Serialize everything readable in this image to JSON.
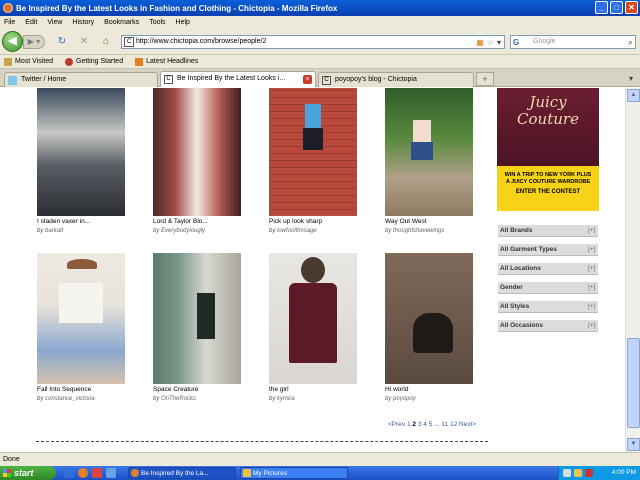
{
  "window": {
    "title": "Be Inspired By the Latest Looks in Fashion and Clothing - Chictopia - Mozilla Firefox"
  },
  "menu": [
    "File",
    "Edit",
    "View",
    "History",
    "Bookmarks",
    "Tools",
    "Help"
  ],
  "nav": {
    "url": "http://www.chictopia.com/browse/people/2",
    "search_placeholder": "Google"
  },
  "bookmarks": [
    "Most Visited",
    "Getting Started",
    "Latest Headlines"
  ],
  "tabs": [
    {
      "label": "Twitter / Home",
      "active": false
    },
    {
      "label": "Be Inspired By the Latest Looks i...",
      "active": true
    },
    {
      "label": "poyopoy's blog - Chictopia",
      "active": false
    }
  ],
  "looks": [
    {
      "title": "I staden vaxer in...",
      "author": "barkatt"
    },
    {
      "title": "Lord & Taylor Blo...",
      "author": "Everybodyiougly"
    },
    {
      "title": "Pick up look sharp",
      "author": "lowfoolfimsage"
    },
    {
      "title": "Way Out West",
      "author": "thoughtshavewings"
    },
    {
      "title": "Fall Into Sequence",
      "author": "constance_victoria"
    },
    {
      "title": "Space Creature",
      "author": "OnTheRocks"
    },
    {
      "title": "the girl",
      "author": "kymira"
    },
    {
      "title": "Hi world",
      "author": "poyopoy"
    }
  ],
  "ad": {
    "brand": "Juicy Couture",
    "line1": "WIN A TRIP TO NEW YORK PLUS",
    "line2": "A JUICY COUTURE WARDROBE",
    "cta": "ENTER THE CONTEST"
  },
  "filters": [
    {
      "label": "All Brands",
      "toggle": "[+]"
    },
    {
      "label": "All Garment Types",
      "toggle": "[+]"
    },
    {
      "label": "All Locations",
      "toggle": "[+]"
    },
    {
      "label": "Gender",
      "toggle": "[+]"
    },
    {
      "label": "All Styles",
      "toggle": "[+]"
    },
    {
      "label": "All Occasions",
      "toggle": "[+]"
    }
  ],
  "pagination": {
    "prev": "<Prev",
    "p1": "1",
    "current": "2",
    "p3": "3",
    "p4": "4",
    "p5": "5",
    "ellipsis": "...",
    "p11": "11",
    "p12": "12",
    "next": "Next>"
  },
  "status": "Done",
  "taskbar": {
    "start": "start",
    "tasks": [
      "Be Inspired By the La...",
      "My Pictures"
    ],
    "clock": "4:00 PM"
  }
}
